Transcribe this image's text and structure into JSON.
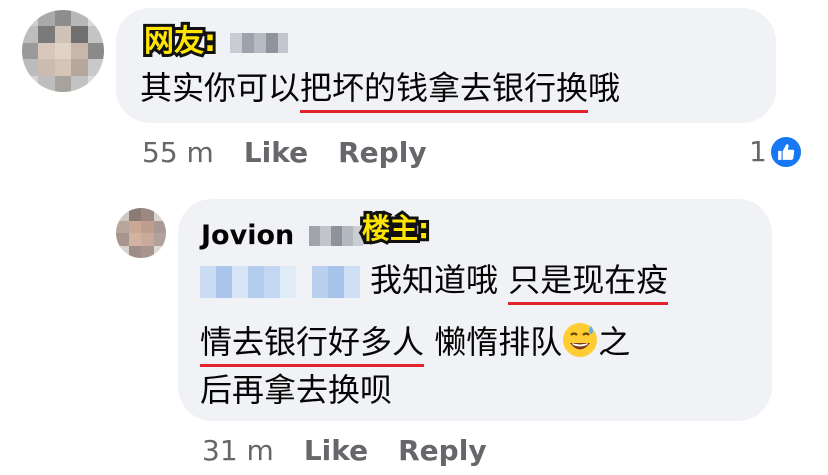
{
  "comment1": {
    "tag": "网友:",
    "text_pre": "其实你可以",
    "text_underlined": "把坏的钱拿去银行换",
    "text_post": "哦",
    "time": "55 m",
    "like_label": "Like",
    "reply_label": "Reply",
    "reaction_count": "1"
  },
  "reply": {
    "author_first_name": "Jovion",
    "tag": "楼主:",
    "line1_pre": "我知道哦 ",
    "line1_underlined": "只是现在疫",
    "line2_underlined": "情去银行好多人",
    "line2_post": " 懒惰排队",
    "line2_tail": "之",
    "line3": "后再拿去换呗",
    "emoji": "sweat-smile-emoji",
    "time": "31 m",
    "like_label": "Like",
    "reply_label": "Reply"
  },
  "colors": {
    "bubble_bg": "#f0f2f5",
    "tag_fill": "#ffe500",
    "underline": "#e0242e",
    "meta": "#65676b",
    "like_blue": "#1877f2"
  }
}
